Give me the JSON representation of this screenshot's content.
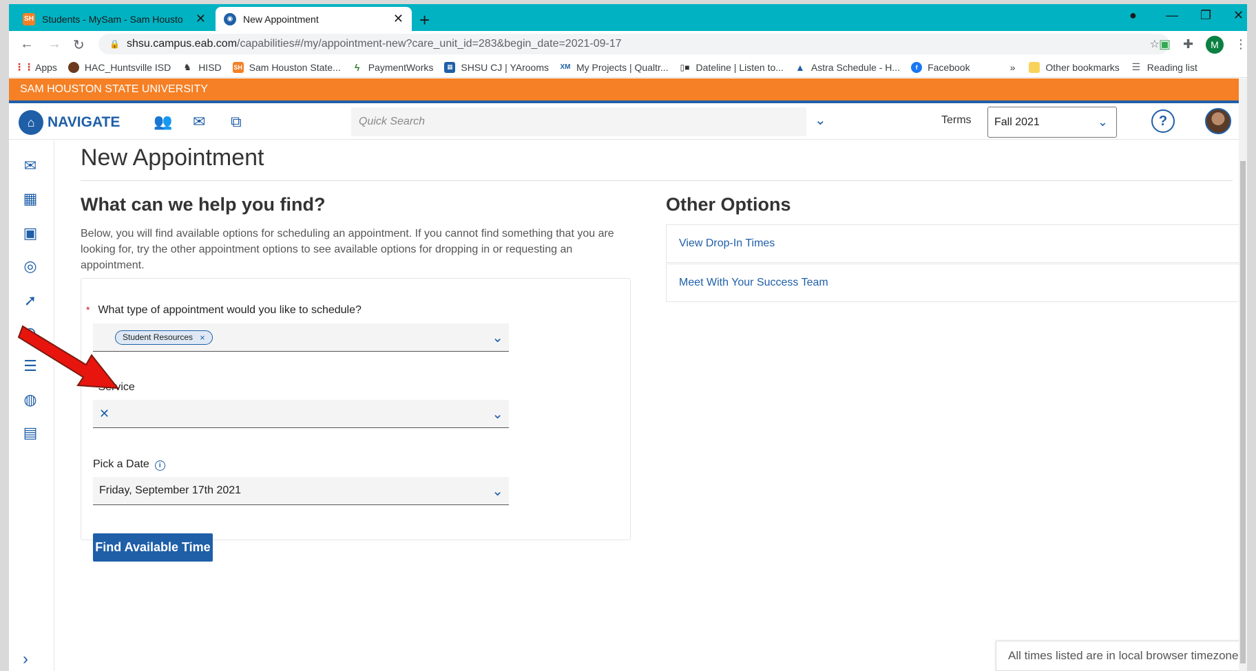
{
  "browser": {
    "tabs": [
      {
        "title": "Students - MySam - Sam Housto",
        "active": false
      },
      {
        "title": "New Appointment",
        "active": true
      }
    ],
    "url_host": "shsu.campus.eab.com",
    "url_path": "/capabilities#/my/appointment-new?care_unit_id=283&begin_date=2021-09-17",
    "profile_initial": "M",
    "bookmarks": [
      "Apps",
      "HAC_Huntsville ISD",
      "HISD",
      "Sam Houston State...",
      "PaymentWorks",
      "SHSU CJ | YArooms",
      "My Projects | Qualtr...",
      "Dateline | Listen to...",
      "Astra Schedule - H...",
      "Facebook",
      "Other bookmarks",
      "Reading list"
    ]
  },
  "banner": "SAM HOUSTON STATE UNIVERSITY",
  "header": {
    "brand": "NAVIGATE",
    "search_placeholder": "Quick Search",
    "terms_label": "Terms",
    "term_value": "Fall 2021"
  },
  "page": {
    "title": "New Appointment",
    "find_heading": "What can we help you find?",
    "intro": "Below, you will find available options for scheduling an appointment. If you cannot find something that you are looking for, try the other appointment options to see available options for dropping in or requesting an appointment.",
    "form": {
      "type_label": "What type of appointment would you like to schedule?",
      "type_value": "Student Resources",
      "service_label": "Service",
      "date_label": "Pick a Date",
      "date_value": "Friday, September 17th 2021",
      "submit": "Find Available Time"
    },
    "other_heading": "Other Options",
    "other_options": [
      "View Drop-In Times",
      "Meet With Your Success Team"
    ],
    "timezone_note": "All times listed are in local browser timezone."
  },
  "colors": {
    "brand_blue": "#1f5fa8",
    "banner_orange": "#f58025",
    "tabstrip_teal": "#00b2c2",
    "annotation_red": "#e8150e"
  }
}
